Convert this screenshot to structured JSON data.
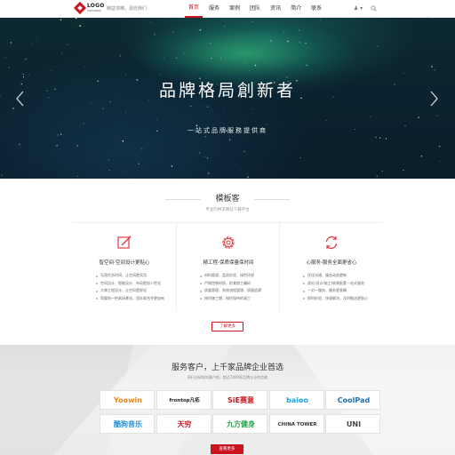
{
  "header": {
    "logo_main": "LOGO",
    "logo_sub": "company",
    "slogan": "精益求精，源自我们",
    "nav": [
      "首页",
      "服务",
      "案例",
      "团队",
      "资讯",
      "简介",
      "联系"
    ],
    "user_label": "♟ ▾"
  },
  "banner": {
    "title": "品牌格局創新者",
    "subtitle": "一站式品牌服務提供商",
    "slides": 4,
    "active_slide": 1
  },
  "services": {
    "title": "模板客",
    "subtitle": "专业的供求网站下载平台",
    "columns": [
      {
        "icon": "edit-icon",
        "title": "智空间-空间设计更贴心",
        "items": [
          "无限任务时间，让空间更实用",
          "空间设计、智能设计、布局更加人性化",
          "大神工程设计，让空间更舒适",
          "简要的一把具场景化，团队联合齐更加有"
        ]
      },
      {
        "icon": "gear-icon",
        "title": "精工程-保质保量保时间",
        "items": [
          "材料管理、监测实验、绿色环保",
          "严格控制材质，检查修工编码",
          "质量管理、系统流程管理、质量追溯",
          "按时施工期，按约保持的竣工"
        ]
      },
      {
        "icon": "refresh-icon",
        "title": "心服务-服务全面更省心",
        "items": [
          "优化沟通，服务动态更新",
          "选址/设计/施工/软装配套一站式服务",
          "一对一服务、服务更准确",
          "即时检验、快速解决、及时推送更贴心"
        ]
      }
    ],
    "more_label": "了解更多"
  },
  "clients": {
    "title": "服务客户，上千家品牌企业首选",
    "subtitle": "网行自研发的客户前，超过1000家品牌企业的信赖",
    "logos": [
      {
        "name": "Yoowin",
        "color": "#e98a16"
      },
      {
        "name": "frontop凡拓",
        "color": "#222222"
      },
      {
        "name": "SiE赛意",
        "color": "#c9151e"
      },
      {
        "name": "baioo",
        "color": "#1aa3e0"
      },
      {
        "name": "CoolPad",
        "color": "#1f6fb5"
      },
      {
        "name": "酷狗音乐",
        "color": "#1d8fe0"
      },
      {
        "name": "天穷",
        "color": "#c9151e"
      },
      {
        "name": "九方健身",
        "color": "#2ea04f"
      },
      {
        "name": "CHINA TOWER",
        "color": "#333333"
      },
      {
        "name": "UNI",
        "color": "#444444"
      }
    ],
    "more_label": "查看更多"
  },
  "colors": {
    "accent": "#c9151e",
    "banner_dark": "#0b2330",
    "nebula": "#3cdc8c"
  }
}
